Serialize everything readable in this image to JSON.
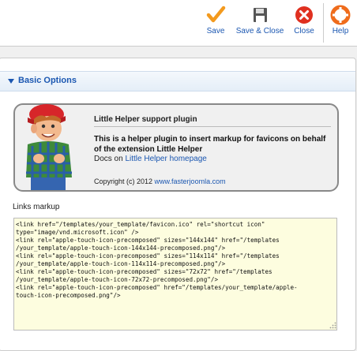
{
  "toolbar": {
    "save_label": "Save",
    "save_close_label": "Save & Close",
    "close_label": "Close",
    "help_label": "Help"
  },
  "panel": {
    "title": "Basic Options"
  },
  "info": {
    "title": "Little Helper support plugin",
    "description": "This is a helper plugin to insert markup for favicons on behalf of the extension Little Helper",
    "docs_prefix": "Docs on ",
    "docs_link": "Little Helper homepage",
    "copyright_prefix": "Copyright (c) 2012 ",
    "copyright_link": "www.fasterjoomla.com"
  },
  "links_markup": {
    "label": "Links markup",
    "value": "<link href=\"/templates/your_template/favicon.ico\" rel=\"shortcut icon\"\ntype=\"image/vnd.microsoft.icon\" />\n<link rel=\"apple-touch-icon-precomposed\" sizes=\"144x144\" href=\"/templates\n/your_template/apple-touch-icon-144x144-precomposed.png\"/>\n<link rel=\"apple-touch-icon-precomposed\" sizes=\"114x114\" href=\"/templates\n/your_template/apple-touch-icon-114x114-precomposed.png\"/>\n<link rel=\"apple-touch-icon-precomposed\" sizes=\"72x72\" href=\"/templates\n/your_template/apple-touch-icon-72x72-precomposed.png\"/>\n<link rel=\"apple-touch-icon-precomposed\" href=\"/templates/your_template/apple-\ntouch-icon-precomposed.png\"/>"
  },
  "icons": {
    "save": "checkmark-icon",
    "save_close": "floppy-disk-icon",
    "close": "close-x-icon",
    "help": "lifebuoy-icon",
    "collapse": "triangle-down-icon",
    "mascot": "mascot-icon"
  },
  "colors": {
    "accent": "#1b57b1",
    "save_orange": "#f39a1e",
    "close_red": "#e03020",
    "help_orange": "#ef6c1c",
    "textarea_bg": "#fdfddf"
  }
}
